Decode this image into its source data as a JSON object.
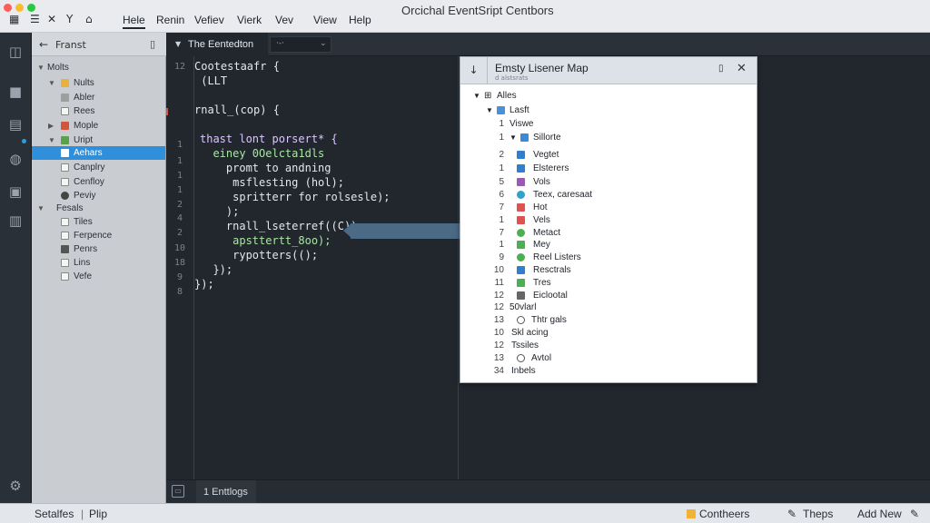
{
  "window": {
    "title": "Orcichal EventSript Centbors",
    "menu": [
      "Hele",
      "Renin",
      "Vefiev",
      "Vierk",
      "Vev",
      "View",
      "Help"
    ],
    "toolbar_icons": [
      "grid-icon",
      "close-icon",
      "filter-icon",
      "home-icon"
    ]
  },
  "sidebar": {
    "header_title": "Franst",
    "items": [
      {
        "label": "Molts"
      },
      {
        "label": "Nults"
      },
      {
        "label": "Abler"
      },
      {
        "label": "Rees"
      },
      {
        "label": "Mople"
      },
      {
        "label": "Uript"
      },
      {
        "label": "Aehars"
      },
      {
        "label": "Canplry"
      },
      {
        "label": "Cenfloy"
      },
      {
        "label": "Peviy"
      },
      {
        "label": "Fesals"
      },
      {
        "label": "Tiles"
      },
      {
        "label": "Ferpence"
      },
      {
        "label": "Penrs"
      },
      {
        "label": "Lins"
      },
      {
        "label": "Vefe"
      }
    ]
  },
  "editor": {
    "tab_label": "The Eentedton",
    "tab2_label": "·‑·",
    "gutter": [
      "12",
      "1",
      "1",
      "1",
      "1",
      "2",
      "4",
      "2",
      "10",
      "18",
      "9",
      "8"
    ],
    "code": [
      "Cootestaafr {",
      " (LLT",
      "rnall_(cop) {",
      "thast lont porsert* {",
      "  einey 0Oelcta1dls",
      "    promt to andning",
      "     msflesting (hol);",
      "     spritterr for rolsesle);",
      "    );",
      "    rnall_lseterref((C));",
      "     apsttertt_8oo);",
      "     rypotters(();",
      "  });",
      "});"
    ],
    "bottom_tab": "1 Enttlogs"
  },
  "panel": {
    "title": "Emsty Lisener Map",
    "subtitle": "d alstsrats",
    "root": "Alles",
    "folder": "Lasft",
    "rows": [
      {
        "num": "1",
        "label": "Viswe"
      },
      {
        "num": "1",
        "label": "Sillorte"
      },
      {
        "num": "2",
        "label": "Vegtet"
      },
      {
        "num": "1",
        "label": "Elsterers"
      },
      {
        "num": "5",
        "label": "Vols"
      },
      {
        "num": "6",
        "label": "Teex, caresaat"
      },
      {
        "num": "7",
        "label": "Hot"
      },
      {
        "num": "1",
        "label": "Vels"
      },
      {
        "num": "7",
        "label": "Metact"
      },
      {
        "num": "1",
        "label": "Mey"
      },
      {
        "num": "9",
        "label": "Reel Listers"
      },
      {
        "num": "10",
        "label": "Resctrals"
      },
      {
        "num": "11",
        "label": "Tres"
      },
      {
        "num": "12",
        "label": "Eiclootal"
      },
      {
        "num": "12",
        "label": "50vlarl"
      },
      {
        "num": "13",
        "label": "Thtr gals"
      },
      {
        "num": "10",
        "label": "Skl acing"
      },
      {
        "num": "12",
        "label": "Tssiles"
      },
      {
        "num": "13",
        "label": "Avtol"
      },
      {
        "num": "34",
        "label": "Inbels"
      }
    ]
  },
  "statusbar": {
    "left": "Setalfes",
    "left2": "Plip",
    "contheers": "Contheers",
    "theps": "Theps",
    "add_new": "Add New"
  },
  "colors": {
    "accent": "#2f8fdb",
    "editor_bg": "#22272e",
    "sidebar_bg": "#c9cdd2"
  }
}
